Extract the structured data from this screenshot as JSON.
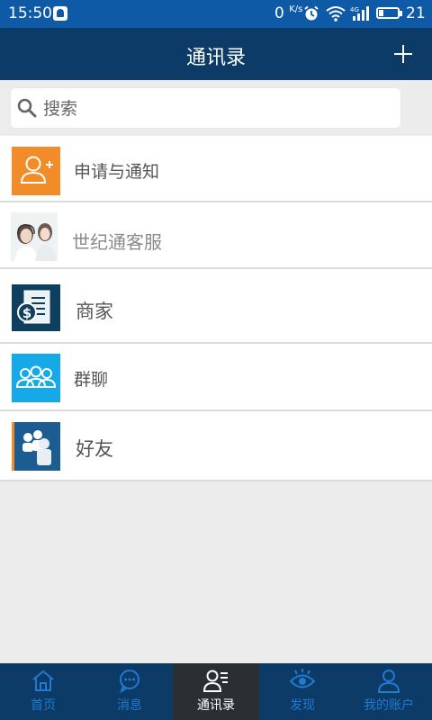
{
  "status_bar": {
    "time": "15:50",
    "speed_value": "0",
    "speed_unit": "K/s",
    "network": "4G",
    "battery_level": "21",
    "battery_fraction": 0.21,
    "icons": [
      "notification-icon",
      "alarm-icon",
      "wifi-icon",
      "signal-icon",
      "battery-icon"
    ]
  },
  "header": {
    "title": "通讯录",
    "add_icon": "plus-icon"
  },
  "search": {
    "placeholder": "搜索",
    "icon": "search-icon"
  },
  "contacts": [
    {
      "label": "申请与通知",
      "icon": "add-user-icon",
      "color": "#f28c28"
    },
    {
      "label": "世纪通客服",
      "icon": "customer-service-photo"
    },
    {
      "label": "商家",
      "icon": "merchant-icon",
      "color": "#0f3f5f"
    },
    {
      "label": "群聊",
      "icon": "group-chat-icon",
      "color": "#16a9e8"
    },
    {
      "label": "好友",
      "icon": "friends-icon",
      "color": "#1b5c92"
    }
  ],
  "bottom_nav": {
    "active": "通讯录",
    "tabs": [
      {
        "label": "首页",
        "icon": "home-icon"
      },
      {
        "label": "消息",
        "icon": "message-icon"
      },
      {
        "label": "通讯录",
        "icon": "contacts-icon"
      },
      {
        "label": "发现",
        "icon": "eye-icon"
      },
      {
        "label": "我的账户",
        "icon": "user-icon"
      }
    ]
  },
  "colors": {
    "status_bar": "#0e5aa7",
    "header": "#0b3b66",
    "nav_inactive": "#1f7ad0",
    "nav_active_bg": "#2a2f33",
    "background": "#ececec"
  }
}
